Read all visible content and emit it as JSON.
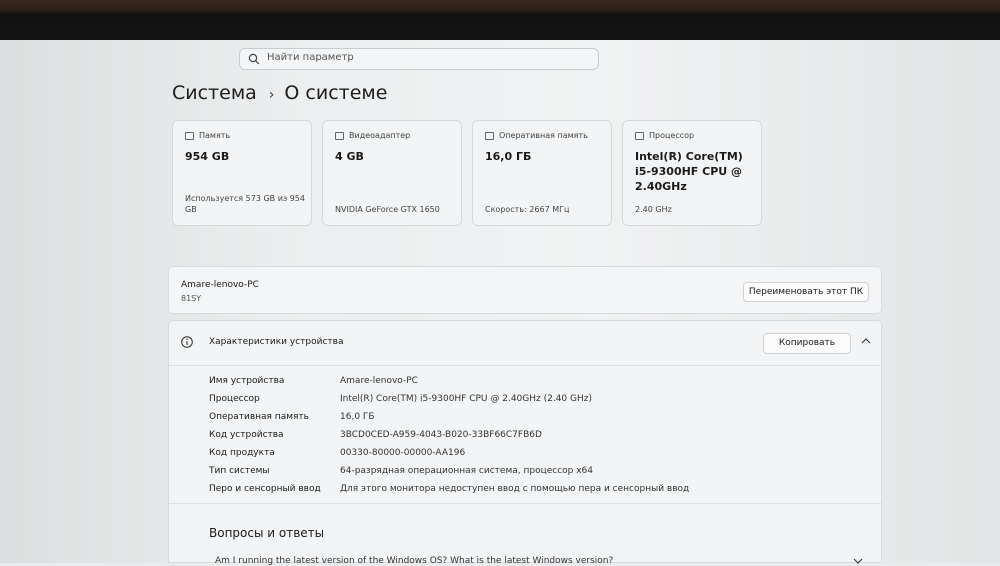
{
  "search": {
    "placeholder": "Найти параметр",
    "icon": "search-icon"
  },
  "breadcrumb": {
    "parent": "Система",
    "current": "О системе"
  },
  "cards": [
    {
      "icon": "storage-icon",
      "label": "Память",
      "value": "954 GB",
      "detail": "Используется 573 GB из 954 GB"
    },
    {
      "icon": "gpu-icon",
      "label": "Видеоадаптер",
      "value": "4 GB",
      "detail": "NVIDIA GeForce GTX 1650"
    },
    {
      "icon": "ram-icon",
      "label": "Оперативная память",
      "value": "16,0 ГБ",
      "detail": "Скорость: 2667 МГц"
    },
    {
      "icon": "cpu-icon",
      "label": "Процессор",
      "value": "Intel(R) Core(TM) i5-9300HF CPU @ 2.40GHz",
      "detail": "2.40 GHz"
    }
  ],
  "device": {
    "name": "Amare-lenovo-PC",
    "model": "81SY",
    "rename_label": "Переименовать этот ПК"
  },
  "specs": {
    "title": "Характеристики устройства",
    "copy_label": "Копировать",
    "rows": [
      {
        "key": "Имя устройства",
        "value": "Amare-lenovo-PC"
      },
      {
        "key": "Процессор",
        "value": "Intel(R) Core(TM) i5-9300HF CPU @ 2.40GHz (2.40 GHz)"
      },
      {
        "key": "Оперативная память",
        "value": "16,0 ГБ"
      },
      {
        "key": "Код устройства",
        "value": "3BCD0CED-A959-4043-B020-33BF66C7FB6D"
      },
      {
        "key": "Код продукта",
        "value": "00330-80000-00000-AA196"
      },
      {
        "key": "Тип системы",
        "value": "64-разрядная операционная система, процессор x64"
      },
      {
        "key": "Перо и сенсорный ввод",
        "value": "Для этого монитора недоступен ввод с помощью пера и сенсорный ввод"
      }
    ]
  },
  "faq": {
    "title": "Вопросы и ответы",
    "question": "Am I running the latest version of the Windows OS? What is the latest Windows version?"
  }
}
